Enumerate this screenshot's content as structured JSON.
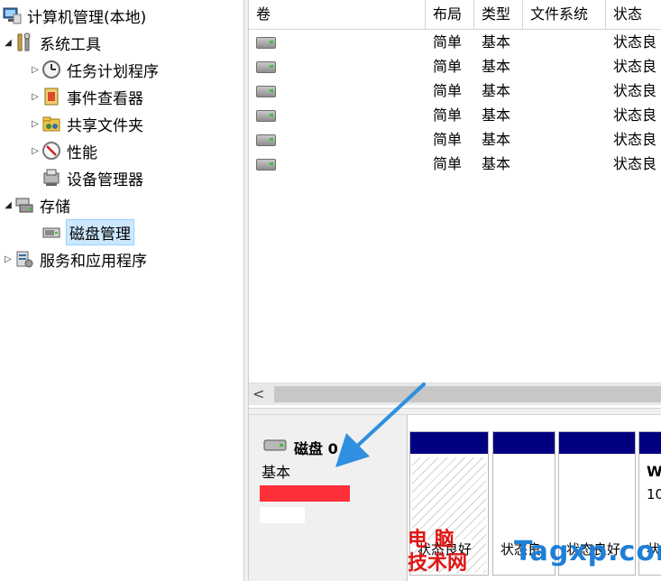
{
  "tree": {
    "root": "计算机管理(本地)",
    "system_tools": "系统工具",
    "task_scheduler": "任务计划程序",
    "event_viewer": "事件查看器",
    "shared_folders": "共享文件夹",
    "performance": "性能",
    "device_manager": "设备管理器",
    "storage": "存储",
    "disk_management": "磁盘管理",
    "services_apps": "服务和应用程序"
  },
  "columns": [
    "卷",
    "布局",
    "类型",
    "文件系统",
    "状态"
  ],
  "rows": [
    {
      "layout": "简单",
      "type": "基本",
      "status": "状态良"
    },
    {
      "layout": "简单",
      "type": "基本",
      "status": "状态良"
    },
    {
      "layout": "简单",
      "type": "基本",
      "status": "状态良"
    },
    {
      "layout": "简单",
      "type": "基本",
      "status": "状态良"
    },
    {
      "layout": "简单",
      "type": "基本",
      "status": "状态良"
    },
    {
      "layout": "简单",
      "type": "基本",
      "status": "状态良"
    }
  ],
  "disk": {
    "title": "磁盘 0",
    "type": "基本",
    "partitions": [
      {
        "status": "状态良好",
        "hatched": true
      },
      {
        "status": "状态良",
        "hatched": false
      },
      {
        "status": "状态良好",
        "hatched": false
      },
      {
        "status": "状",
        "label": "W",
        "capacity": "10",
        "hatched": false
      }
    ]
  },
  "watermark": {
    "cn_line1": "电 脑",
    "cn_line2": "技术网",
    "en": "Tagxp.com"
  },
  "colors": {
    "partition_bar": "#000080",
    "selection": "#cce8ff",
    "annotation_arrow": "#2f8fe0",
    "redaction": "#ff2f3a"
  },
  "icons": [
    "computer-management-icon",
    "tools-icon",
    "clock-icon",
    "event-log-icon",
    "shared-folder-icon",
    "performance-icon",
    "device-manager-icon",
    "storage-icon",
    "disk-icon",
    "services-icon",
    "drive-icon"
  ]
}
